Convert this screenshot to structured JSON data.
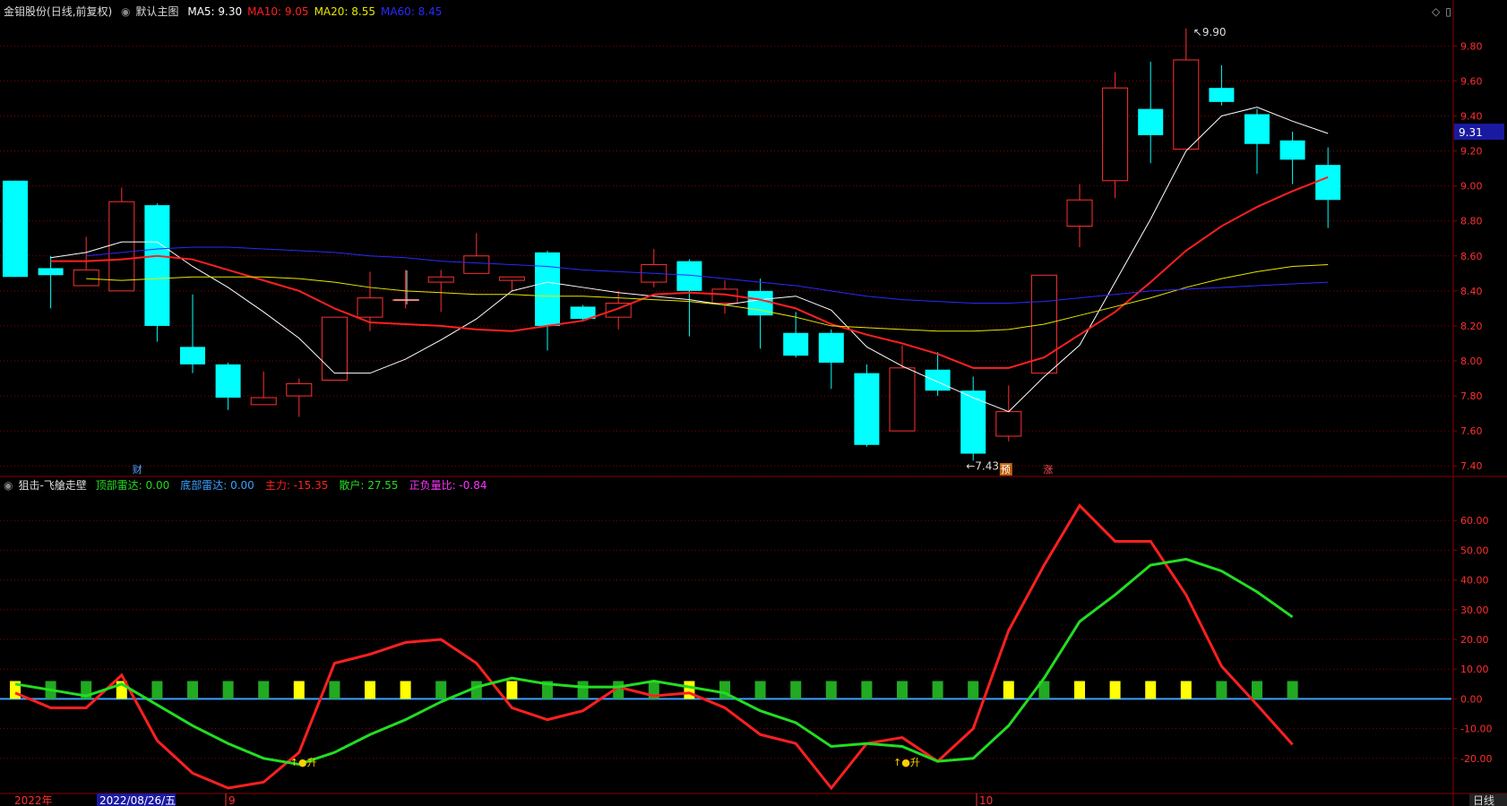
{
  "main_header": {
    "stock": "金钼股份",
    "mode": "(日线,前复权)",
    "chart_name": "默认主图",
    "ma": [
      {
        "label": "MA5:",
        "value": "9.30",
        "color": "#ffffff"
      },
      {
        "label": "MA10:",
        "value": "9.05",
        "color": "#ff2020"
      },
      {
        "label": "MA20:",
        "value": "8.55",
        "color": "#e8e800"
      },
      {
        "label": "MA60:",
        "value": "8.45",
        "color": "#2a2aff"
      }
    ]
  },
  "sub_header": {
    "name": "狙击-飞艙走壁",
    "items": [
      {
        "label": "顶部雷达:",
        "value": "0.00",
        "color": "#22dd22"
      },
      {
        "label": "底部雷达:",
        "value": "0.00",
        "color": "#3aa0ff"
      },
      {
        "label": "主力:",
        "value": "-15.35",
        "color": "#ff2020"
      },
      {
        "label": "散户:",
        "value": "27.55",
        "color": "#22dd22"
      },
      {
        "label": "正负量比:",
        "value": "-0.84",
        "color": "#ff33ff"
      }
    ]
  },
  "price_tag": "9.31",
  "max_label": "9.90",
  "min_label": "7.43",
  "markers": {
    "cai": "财",
    "yu": "预",
    "zhang": "涨"
  },
  "signals": [
    "↑●升",
    "↑●升"
  ],
  "date_axis": {
    "year": "2022年",
    "cursor_date": "2022/08/26/五",
    "m9": "9",
    "m10": "10"
  },
  "period": "日线",
  "colors": {
    "up": "#ff3030",
    "down": "#00ffff",
    "grid": "#8b0000",
    "axis_text": "#ff3030"
  },
  "chart_data": [
    {
      "type": "candlestick",
      "ylim": [
        7.35,
        9.95
      ],
      "yticks": [
        "9.80",
        "9.60",
        "9.40",
        "9.20",
        "9.00",
        "8.80",
        "8.60",
        "8.40",
        "8.20",
        "8.00",
        "7.80",
        "7.60",
        "7.40"
      ],
      "candles": [
        {
          "o": 9.03,
          "h": 9.03,
          "l": 8.48,
          "c": 8.48
        },
        {
          "o": 8.53,
          "h": 8.6,
          "l": 8.3,
          "c": 8.49
        },
        {
          "o": 8.43,
          "h": 8.71,
          "l": 8.43,
          "c": 8.52
        },
        {
          "o": 8.4,
          "h": 8.99,
          "l": 8.4,
          "c": 8.91
        },
        {
          "o": 8.89,
          "h": 8.9,
          "l": 8.11,
          "c": 8.2
        },
        {
          "o": 8.08,
          "h": 8.38,
          "l": 7.93,
          "c": 7.98
        },
        {
          "o": 7.98,
          "h": 7.99,
          "l": 7.72,
          "c": 7.79
        },
        {
          "o": 7.75,
          "h": 7.94,
          "l": 7.75,
          "c": 7.79
        },
        {
          "o": 7.8,
          "h": 7.9,
          "l": 7.68,
          "c": 7.87
        },
        {
          "o": 7.89,
          "h": 8.25,
          "l": 7.89,
          "c": 8.25
        },
        {
          "o": 8.25,
          "h": 8.51,
          "l": 8.17,
          "c": 8.36
        },
        {
          "o": 8.35,
          "h": 8.52,
          "l": 8.3,
          "c": 8.35
        },
        {
          "o": 8.45,
          "h": 8.52,
          "l": 8.28,
          "c": 8.48
        },
        {
          "o": 8.5,
          "h": 8.73,
          "l": 8.5,
          "c": 8.6
        },
        {
          "o": 8.46,
          "h": 8.48,
          "l": 8.4,
          "c": 8.48
        },
        {
          "o": 8.62,
          "h": 8.63,
          "l": 8.06,
          "c": 8.2
        },
        {
          "o": 8.31,
          "h": 8.32,
          "l": 8.23,
          "c": 8.24
        },
        {
          "o": 8.25,
          "h": 8.4,
          "l": 8.18,
          "c": 8.33
        },
        {
          "o": 8.45,
          "h": 8.64,
          "l": 8.42,
          "c": 8.55
        },
        {
          "o": 8.57,
          "h": 8.58,
          "l": 8.14,
          "c": 8.4
        },
        {
          "o": 8.33,
          "h": 8.46,
          "l": 8.27,
          "c": 8.41
        },
        {
          "o": 8.4,
          "h": 8.47,
          "l": 8.07,
          "c": 8.26
        },
        {
          "o": 8.16,
          "h": 8.28,
          "l": 8.02,
          "c": 8.03
        },
        {
          "o": 8.16,
          "h": 8.18,
          "l": 7.84,
          "c": 7.99
        },
        {
          "o": 7.93,
          "h": 7.98,
          "l": 7.51,
          "c": 7.52
        },
        {
          "o": 7.6,
          "h": 8.09,
          "l": 7.6,
          "c": 7.96
        },
        {
          "o": 7.95,
          "h": 8.05,
          "l": 7.8,
          "c": 7.83
        },
        {
          "o": 7.83,
          "h": 7.91,
          "l": 7.43,
          "c": 7.47
        },
        {
          "o": 7.57,
          "h": 7.86,
          "l": 7.54,
          "c": 7.71
        },
        {
          "o": 7.93,
          "h": 8.49,
          "l": 7.93,
          "c": 8.49
        },
        {
          "o": 8.77,
          "h": 9.01,
          "l": 8.65,
          "c": 8.92
        },
        {
          "o": 9.03,
          "h": 9.65,
          "l": 8.93,
          "c": 9.56
        },
        {
          "o": 9.44,
          "h": 9.71,
          "l": 9.13,
          "c": 9.29
        },
        {
          "o": 9.21,
          "h": 9.9,
          "l": 9.21,
          "c": 9.72
        },
        {
          "o": 9.56,
          "h": 9.69,
          "l": 9.46,
          "c": 9.48
        },
        {
          "o": 9.41,
          "h": 9.44,
          "l": 9.07,
          "c": 9.24
        },
        {
          "o": 9.26,
          "h": 9.31,
          "l": 9.01,
          "c": 9.15
        },
        {
          "o": 9.12,
          "h": 9.22,
          "l": 8.76,
          "c": 8.92
        }
      ],
      "series": [
        {
          "name": "MA5",
          "color": "#ffffff",
          "values": [
            8.59,
            8.62,
            8.68,
            8.68,
            8.54,
            8.42,
            8.28,
            8.13,
            7.93,
            7.93,
            8.01,
            8.12,
            8.24,
            8.4,
            8.45,
            8.42,
            8.39,
            8.37,
            8.35,
            8.32,
            8.35,
            8.37,
            8.29,
            8.08,
            7.97,
            7.88,
            7.79,
            7.71,
            7.91,
            8.09,
            8.45,
            8.81,
            9.2,
            9.4,
            9.45,
            9.37,
            9.3
          ]
        },
        {
          "name": "MA10",
          "color": "#ff2020",
          "values": [
            8.57,
            8.57,
            8.58,
            8.6,
            8.58,
            8.52,
            8.46,
            8.4,
            8.3,
            8.22,
            8.21,
            8.2,
            8.18,
            8.17,
            8.2,
            8.23,
            8.3,
            8.38,
            8.39,
            8.38,
            8.35,
            8.3,
            8.21,
            8.15,
            8.1,
            8.04,
            7.96,
            7.96,
            8.02,
            8.15,
            8.28,
            8.45,
            8.63,
            8.77,
            8.88,
            8.97,
            9.05
          ]
        },
        {
          "name": "MA20",
          "color": "#e8e800",
          "values": [
            8.47,
            8.46,
            8.47,
            8.48,
            8.48,
            8.48,
            8.47,
            8.45,
            8.42,
            8.4,
            8.39,
            8.38,
            8.38,
            8.37,
            8.37,
            8.36,
            8.35,
            8.34,
            8.32,
            8.29,
            8.25,
            8.2,
            8.19,
            8.18,
            8.17,
            8.17,
            8.18,
            8.21,
            8.26,
            8.31,
            8.36,
            8.42,
            8.47,
            8.51,
            8.54,
            8.55
          ]
        },
        {
          "name": "MA60",
          "color": "#2a2aff",
          "values": [
            8.6,
            8.62,
            8.64,
            8.65,
            8.65,
            8.64,
            8.63,
            8.62,
            8.6,
            8.59,
            8.57,
            8.56,
            8.55,
            8.54,
            8.52,
            8.51,
            8.5,
            8.49,
            8.47,
            8.45,
            8.43,
            8.4,
            8.37,
            8.35,
            8.34,
            8.33,
            8.33,
            8.34,
            8.36,
            8.38,
            8.4,
            8.41,
            8.42,
            8.43,
            8.44,
            8.45
          ]
        }
      ]
    },
    {
      "type": "line",
      "ylim": [
        -30,
        70
      ],
      "yticks": [
        "60.00",
        "50.00",
        "40.00",
        "30.00",
        "20.00",
        "10.00",
        "0.00",
        "-10.00",
        "-20.00"
      ],
      "series": [
        {
          "name": "主力",
          "color": "#ff2020",
          "values": [
            2,
            -3,
            -3,
            8,
            -14,
            -25,
            -30,
            -28,
            -18,
            12,
            15,
            19,
            20,
            12,
            -3,
            -7,
            -4,
            4,
            1,
            2,
            -3,
            -12,
            -15,
            -30,
            -15,
            -13,
            -21,
            -10,
            23,
            45,
            65,
            53,
            53,
            35,
            11,
            -2,
            -15.35
          ]
        },
        {
          "name": "散户",
          "color": "#22dd22",
          "values": [
            5,
            3,
            1,
            5,
            -2,
            -9,
            -15,
            -20,
            -22,
            -18,
            -12,
            -7,
            -1,
            4,
            7,
            5,
            4,
            4,
            6,
            4,
            2,
            -4,
            -8,
            -16,
            -15,
            -16,
            -21,
            -20,
            -9,
            7,
            26,
            35,
            45,
            47,
            43,
            36,
            27.55
          ]
        },
        {
          "name": "bars",
          "color": "#22aa22",
          "highlight_color": "#ffff00",
          "values": [
            5,
            5,
            5,
            5,
            5,
            5,
            5,
            5,
            5,
            5,
            5,
            5,
            5,
            5,
            5,
            5,
            5,
            5,
            5,
            5,
            5,
            5,
            5,
            5,
            5,
            5,
            5,
            5,
            5,
            5,
            5,
            5,
            5,
            5,
            5,
            5,
            5
          ],
          "highlight": [
            1,
            0,
            0,
            1,
            0,
            0,
            0,
            0,
            1,
            0,
            1,
            1,
            0,
            0,
            1,
            0,
            0,
            0,
            0,
            1,
            0,
            0,
            0,
            0,
            0,
            0,
            0,
            0,
            1,
            0,
            1,
            1,
            1,
            1,
            0,
            0,
            0
          ]
        }
      ]
    }
  ]
}
